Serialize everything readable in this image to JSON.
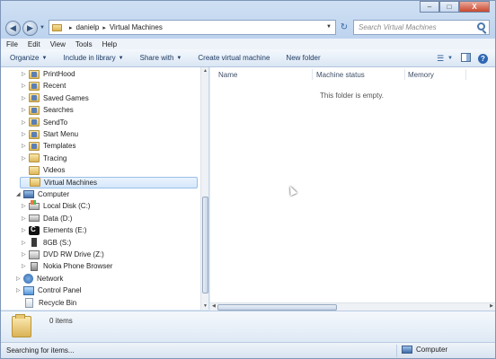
{
  "window": {
    "address": {
      "crumbs": [
        "danielp",
        "Virtual Machines"
      ]
    },
    "search_placeholder": "Search Virtual Machines",
    "controls": [
      "–",
      "□",
      "X"
    ]
  },
  "menu": [
    "File",
    "Edit",
    "View",
    "Tools",
    "Help"
  ],
  "commands": {
    "organize": "Organize",
    "include_in_library": "Include in library",
    "share_with": "Share with",
    "create_vm": "Create virtual machine",
    "new_folder": "New folder"
  },
  "tree": [
    {
      "label": "PrintHood",
      "icon": "folder-special-icon",
      "indent": 0,
      "expandable": true
    },
    {
      "label": "Recent",
      "icon": "folder-special-icon",
      "indent": 0,
      "expandable": true
    },
    {
      "label": "Saved Games",
      "icon": "folder-special-icon",
      "indent": 0,
      "expandable": true
    },
    {
      "label": "Searches",
      "icon": "folder-special-icon",
      "indent": 0,
      "expandable": true
    },
    {
      "label": "SendTo",
      "icon": "folder-special-icon",
      "indent": 0,
      "expandable": true
    },
    {
      "label": "Start Menu",
      "icon": "folder-special-icon",
      "indent": 0,
      "expandable": true
    },
    {
      "label": "Templates",
      "icon": "folder-special-icon",
      "indent": 0,
      "expandable": true
    },
    {
      "label": "Tracing",
      "icon": "folder-icon",
      "indent": 0,
      "expandable": true
    },
    {
      "label": "Videos",
      "icon": "folder-icon",
      "indent": 0,
      "expandable": false
    },
    {
      "label": "Virtual Machines",
      "icon": "folder-icon",
      "indent": 0,
      "expandable": false,
      "selected": true
    },
    {
      "label": "Computer",
      "icon": "computer-icon",
      "indent": -1,
      "expandable": true,
      "expanded": true
    },
    {
      "label": "Local Disk (C:)",
      "icon": "system-drive-icon",
      "indent": 0,
      "expandable": true
    },
    {
      "label": "Data (D:)",
      "icon": "drive-icon",
      "indent": 0,
      "expandable": true
    },
    {
      "label": "Elements (E:)",
      "icon": "elements-drive-icon",
      "indent": 0,
      "expandable": true
    },
    {
      "label": "8GB (S:)",
      "icon": "usb-drive-icon",
      "indent": 0,
      "expandable": true
    },
    {
      "label": "DVD RW Drive (Z:)",
      "icon": "dvd-drive-icon",
      "indent": 0,
      "expandable": true
    },
    {
      "label": "Nokia Phone Browser",
      "icon": "phone-icon",
      "indent": 0,
      "expandable": true
    },
    {
      "label": "Network",
      "icon": "network-icon",
      "indent": -1,
      "expandable": true
    },
    {
      "label": "Control Panel",
      "icon": "control-panel-icon",
      "indent": -1,
      "expandable": true
    },
    {
      "label": "Recycle Bin",
      "icon": "recycle-bin-icon",
      "indent": -1,
      "expandable": false
    }
  ],
  "columns": [
    "Name",
    "Machine status",
    "Memory"
  ],
  "empty_message": "This folder is empty.",
  "details": {
    "count": "0 items"
  },
  "status": {
    "text": "Searching for items...",
    "zone": "Computer"
  }
}
